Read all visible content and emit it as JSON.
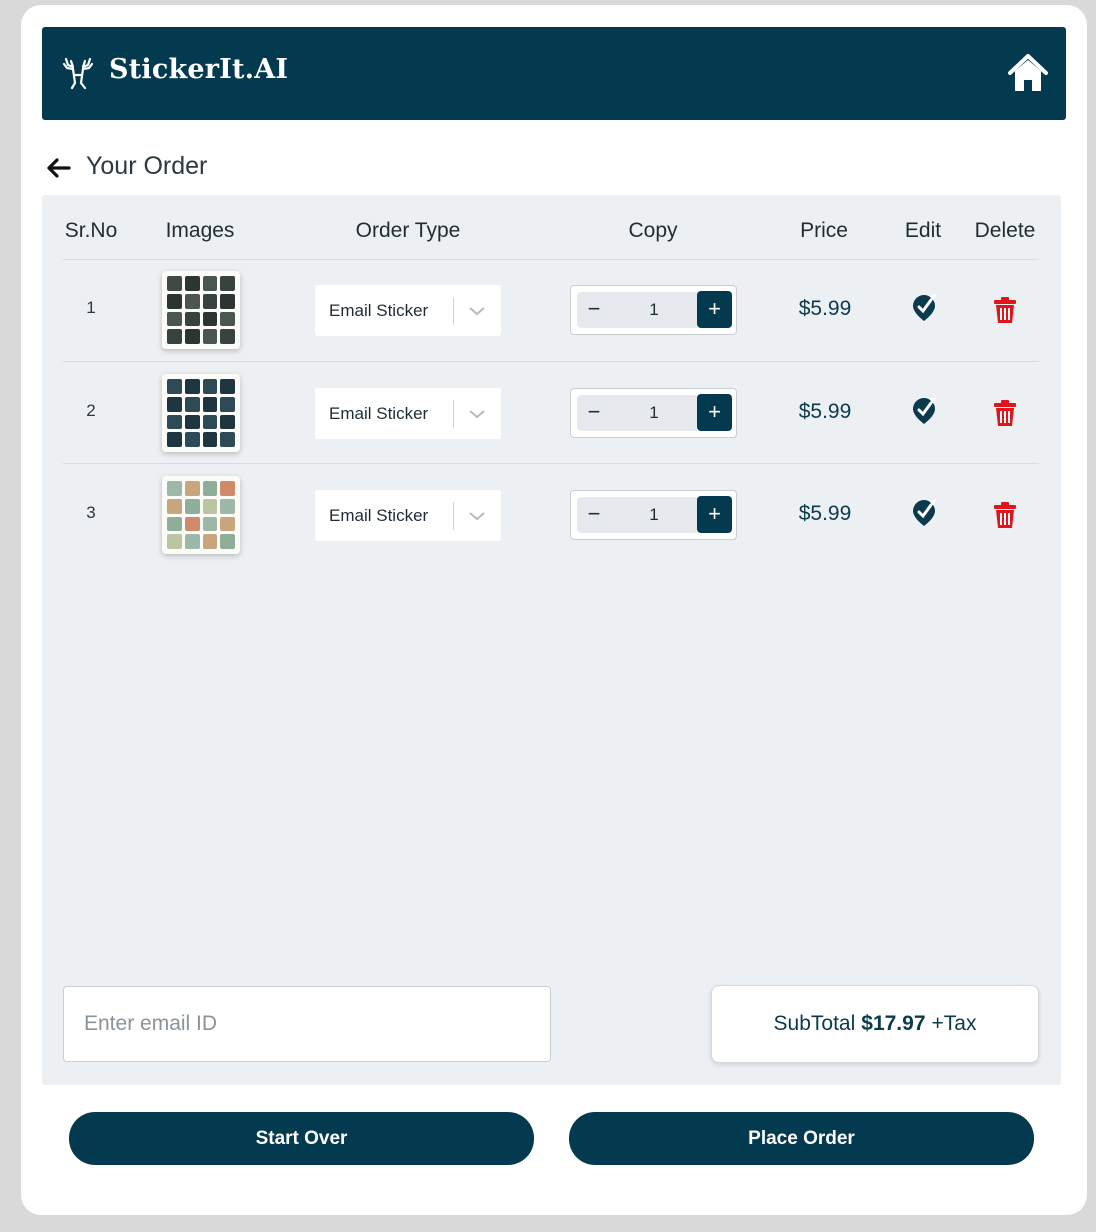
{
  "brand": {
    "name": "StickerIt.AI"
  },
  "icons": {
    "logo": "moose-icon",
    "home": "home-icon",
    "back": "arrow-left-icon",
    "edit": "edit-icon",
    "delete": "trash-icon",
    "dropdown": "chevron-down-icon"
  },
  "colors": {
    "primary": "#043a4f",
    "panel": "#edf0f3",
    "delete": "#e0141b"
  },
  "page": {
    "title": "Your Order"
  },
  "table": {
    "headers": {
      "srno": "Sr.No",
      "images": "Images",
      "order_type": "Order Type",
      "copy": "Copy",
      "price": "Price",
      "edit": "Edit",
      "delete": "Delete"
    },
    "rows": [
      {
        "srno": "1",
        "order_type": "Email Sticker",
        "copy": "1",
        "price": "$5.99"
      },
      {
        "srno": "2",
        "order_type": "Email Sticker",
        "copy": "1",
        "price": "$5.99"
      },
      {
        "srno": "3",
        "order_type": "Email Sticker",
        "copy": "1",
        "price": "$5.99"
      }
    ],
    "stepper": {
      "minus": "−",
      "plus": "+"
    }
  },
  "email": {
    "placeholder": "Enter email ID",
    "value": ""
  },
  "summary": {
    "label": "SubTotal",
    "amount": "$17.97",
    "suffix": "+Tax"
  },
  "actions": {
    "start_over": "Start Over",
    "place_order": "Place Order"
  }
}
